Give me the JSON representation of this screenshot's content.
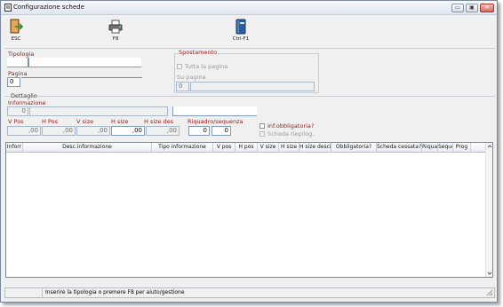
{
  "window": {
    "title": "Configurazione schede",
    "controls": {
      "minimize": "▭",
      "maximize": "▣",
      "close": "✕"
    }
  },
  "toolbar": {
    "buttons": [
      {
        "label": "ESC",
        "icon": "exit-door-icon"
      },
      {
        "label": "F8",
        "icon": "printer-icon"
      },
      {
        "label": "Ctrl-F1",
        "icon": "help-book-icon"
      }
    ]
  },
  "tipologia": {
    "label": "Tipologia",
    "code": "",
    "description": ""
  },
  "pagina": {
    "label": "Pagina",
    "value": "0",
    "description": ""
  },
  "spostamento": {
    "title": "Spostamento",
    "tutta_la_pagina": "Tutta la pagina",
    "su_pagina_label": "Su pagina",
    "su_pagina_value": "0",
    "su_pagina_desc": ""
  },
  "dettaglio": {
    "title": "Dettaglio",
    "informazione_label": "Informazione",
    "informazione_code": "0",
    "informazione_desc": "",
    "informazione_extra": "",
    "fields": [
      {
        "label": "V Pos",
        "value": ",00"
      },
      {
        "label": "H Pos",
        "value": ",00"
      },
      {
        "label": "V size",
        "value": ",00"
      },
      {
        "label": "H size",
        "value": ",00"
      },
      {
        "label": "H size des",
        "value": ",00"
      }
    ],
    "riquadro_label": "Riquadro/sequenza",
    "riquadro_value": "0",
    "sequenza_value": "0",
    "inf_obbligatoria": "Inf.obbligatoria?",
    "scheda_riepilog": "Scheda riepilog."
  },
  "grid": {
    "columns": [
      "Inforr",
      "Desc.informazione",
      "Tipo informazione",
      "V pos",
      "H pos",
      "V size",
      "H size",
      "H size desci",
      "Obbligatoria?",
      "Scheda cessata?",
      "Riqua",
      "Seque",
      "Prog"
    ]
  },
  "status": {
    "left": "",
    "message": "Inserire la tipologia o premere F8 per aiuto/gestione"
  },
  "colors": {
    "label_red": "#8b1a1a",
    "field_border": "#7f9db9"
  }
}
